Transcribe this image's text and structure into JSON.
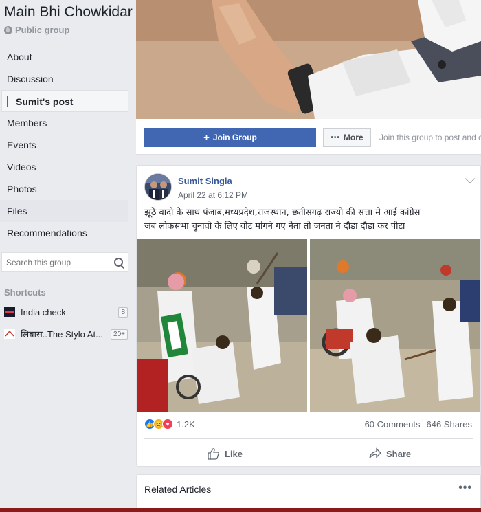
{
  "group": {
    "name": "Main Bhi Chowkidar",
    "privacy": "Public group"
  },
  "sidebar": {
    "items": [
      {
        "label": "About"
      },
      {
        "label": "Discussion"
      },
      {
        "label": "Sumit's post",
        "active": true
      },
      {
        "label": "Members"
      },
      {
        "label": "Events"
      },
      {
        "label": "Videos"
      },
      {
        "label": "Photos"
      },
      {
        "label": "Files"
      },
      {
        "label": "Recommendations"
      }
    ],
    "search_placeholder": "Search this group",
    "shortcuts_title": "Shortcuts",
    "shortcuts": [
      {
        "label": "India check",
        "badge": "8"
      },
      {
        "label": "लिबास..The Stylo At...",
        "badge": "20+"
      }
    ]
  },
  "actions": {
    "join_label": "Join Group",
    "more_label": "More",
    "join_hint": "Join this group to post and c"
  },
  "post": {
    "author": "Sumit Singla",
    "timestamp": "April 22 at 6:12 PM",
    "text_line1": "झूठे वादो के साथ पंजाब,मध्यप्रदेश,राजस्थान, छतीसगढ़ राज्यो की सत्ता मे आई कांग्रेस",
    "text_line2": "जब लोकसभा चुनावो के लिए वोट मांगने गए नेता तो जनता ने दौड़ा दौड़ा कर पीटा",
    "reaction_count": "1.2K",
    "comments": "60 Comments",
    "shares": "646 Shares",
    "like_label": "Like",
    "share_label": "Share"
  },
  "related": {
    "title": "Related Articles",
    "menu": "•••"
  },
  "colors": {
    "brand": "#4267b2",
    "link": "#385898",
    "bg": "#e9ebee"
  }
}
